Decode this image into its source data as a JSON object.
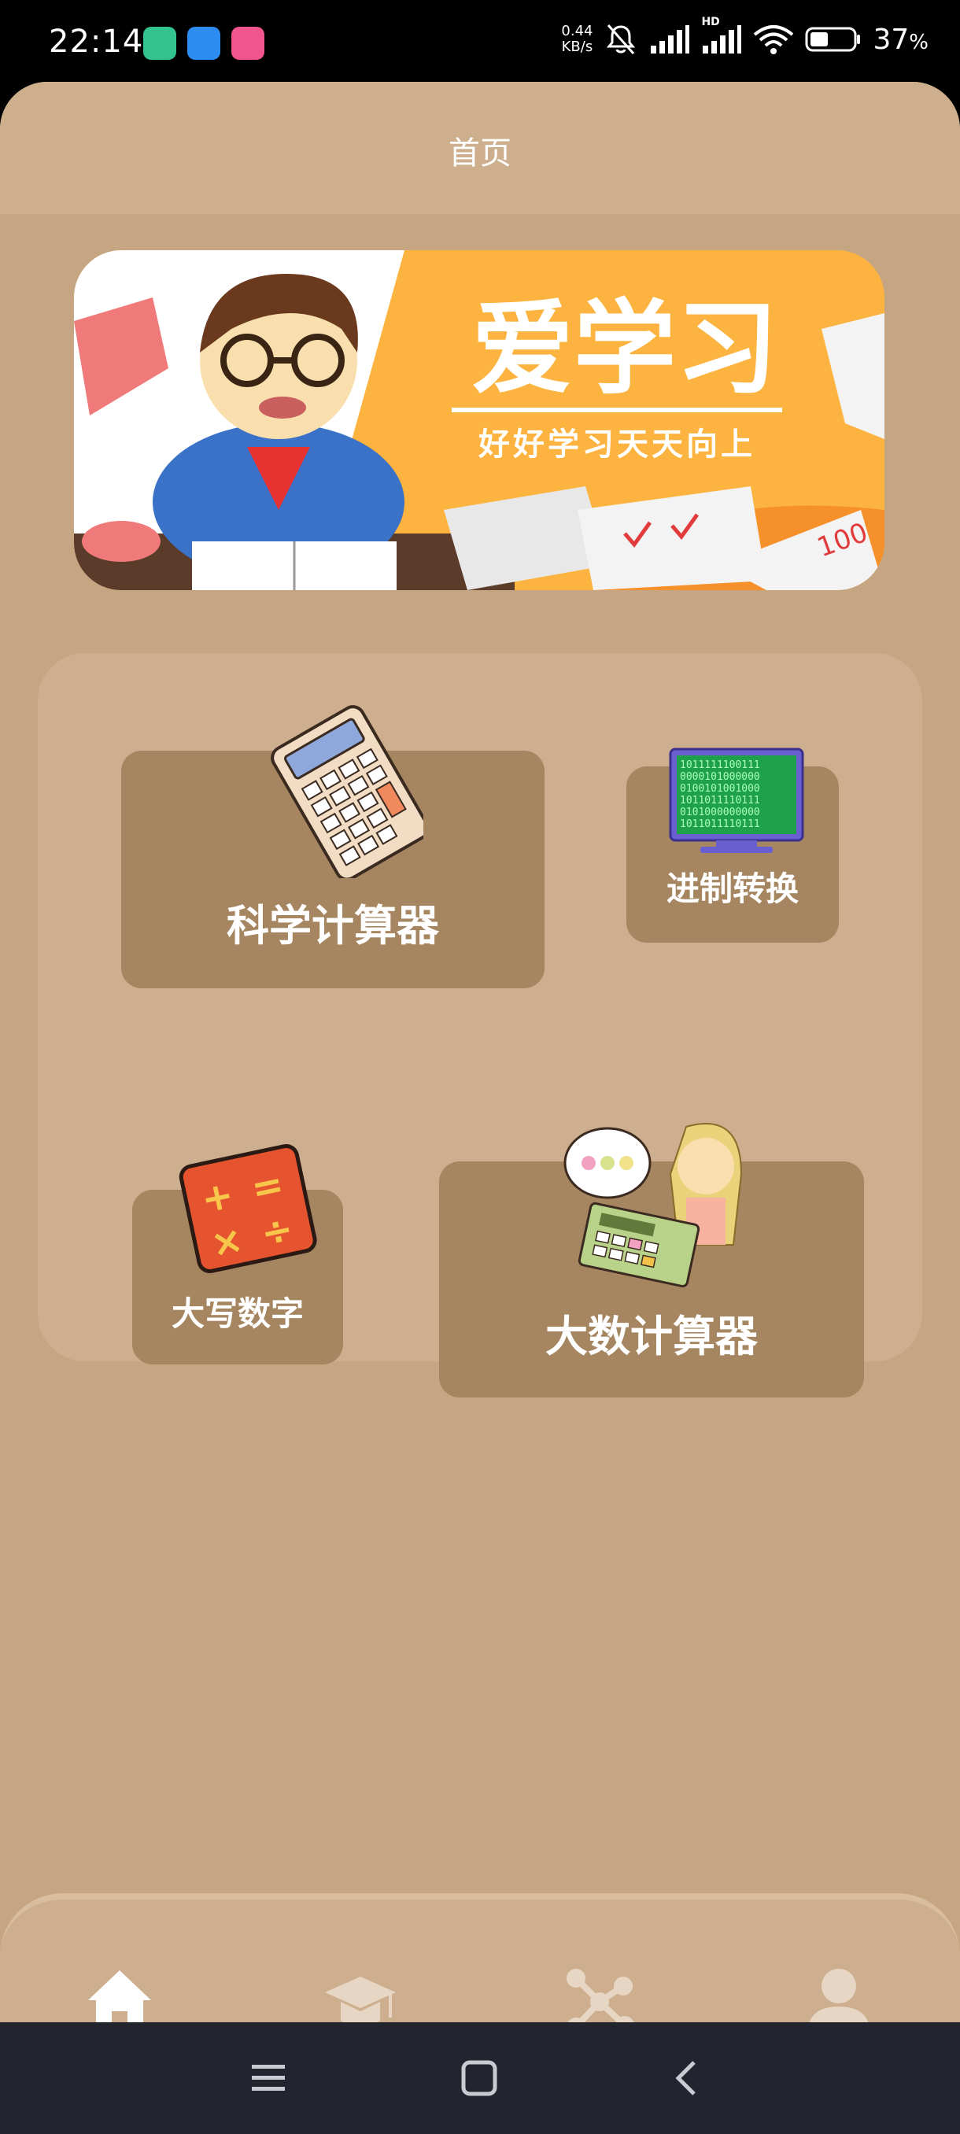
{
  "status_bar": {
    "time": "22:14",
    "net_speed_value": "0.44",
    "net_speed_unit": "KB/s",
    "battery_percent": "37",
    "battery_unit": "%",
    "hd_badge": "HD"
  },
  "header": {
    "title": "首页"
  },
  "banner": {
    "headline": "爱学习",
    "slogan": "好好学习天天向上",
    "doodle": "100"
  },
  "tools": [
    {
      "label": "科学计算器",
      "icon": "calculator-icon"
    },
    {
      "label": "进制转换",
      "icon": "binary-monitor-icon",
      "screen_rows": [
        "1011111100111",
        "0000101000000",
        "0100101001000",
        "1011011110111",
        "0101000000000",
        "1011011110111"
      ]
    },
    {
      "label": "大写数字",
      "icon": "arithmetic-operators-icon",
      "symbols": [
        "+",
        "=",
        "×",
        "÷"
      ]
    },
    {
      "label": "大数计算器",
      "icon": "girl-with-calculator-icon"
    }
  ],
  "bottom_nav": [
    {
      "icon": "home-icon",
      "active": true
    },
    {
      "icon": "graduation-cap-icon",
      "active": false
    },
    {
      "icon": "nodes-icon",
      "active": false
    },
    {
      "icon": "user-icon",
      "active": false
    }
  ],
  "colors": {
    "app_bg": "#c6a583",
    "topbar_bg": "#cdaf8e",
    "panel_bg": "#cdae8e",
    "tool_bg": "#a58661",
    "banner_orange": "#fdb33f",
    "nav_active": "#ffffff",
    "nav_inactive": "#e7d6c3"
  }
}
